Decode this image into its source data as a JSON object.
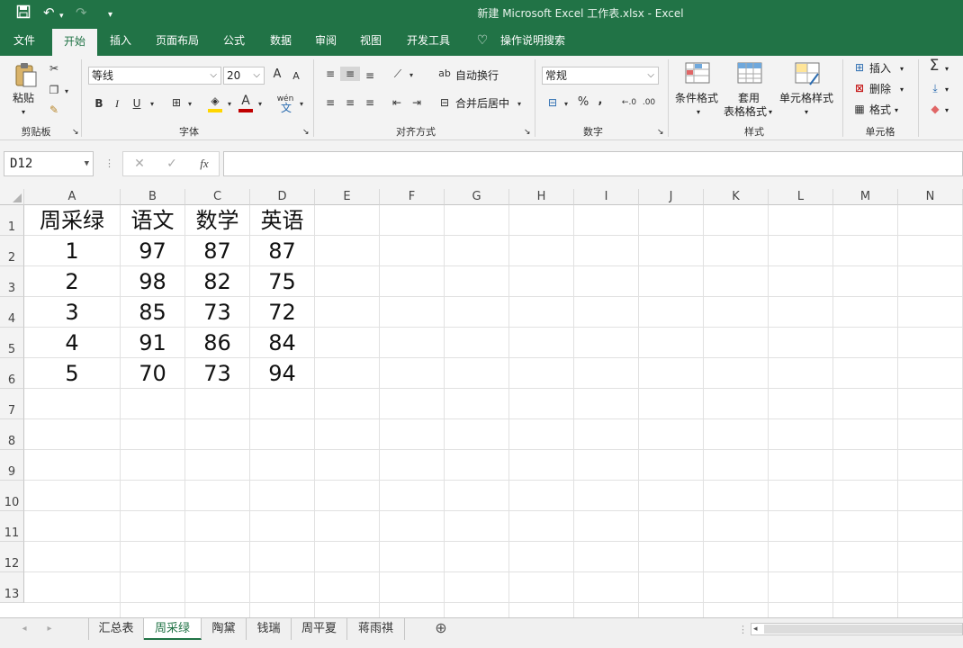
{
  "window": {
    "title": "新建 Microsoft Excel 工作表.xlsx  -  Excel"
  },
  "ribbon_tabs": [
    "文件",
    "开始",
    "插入",
    "页面布局",
    "公式",
    "数据",
    "审阅",
    "视图",
    "开发工具",
    "操作说明搜索"
  ],
  "active_tab": "开始",
  "clipboard": {
    "paste": "粘贴",
    "group": "剪贴板"
  },
  "font": {
    "name": "等线",
    "size": "20",
    "bold": "B",
    "italic": "I",
    "underline": "U",
    "grow": "A",
    "shrink": "A",
    "color_letter": "A",
    "phonetic": "wén",
    "group": "字体"
  },
  "alignment": {
    "wrap": "自动换行",
    "merge": "合并后居中",
    "group": "对齐方式"
  },
  "number": {
    "format": "常规",
    "percent": "%",
    "comma": ",",
    "group": "数字"
  },
  "styles": {
    "conditional": "条件格式",
    "table_line1": "套用",
    "table_line2": "表格格式",
    "cell_styles": "单元格样式",
    "group": "样式"
  },
  "cells": {
    "insert": "插入",
    "delete": "删除",
    "format": "格式",
    "group": "单元格"
  },
  "formula_bar": {
    "name_box": "D12",
    "fx": "fx",
    "cancel": "✕",
    "enter": "✓",
    "content": ""
  },
  "columns": [
    "A",
    "B",
    "C",
    "D",
    "E",
    "F",
    "G",
    "H",
    "I",
    "J",
    "K",
    "L",
    "M",
    "N"
  ],
  "rows": [
    "1",
    "2",
    "3",
    "4",
    "5",
    "6",
    "7",
    "8",
    "9",
    "10",
    "11",
    "12",
    "13"
  ],
  "table": [
    [
      "周采绿",
      "语文",
      "数学",
      "英语"
    ],
    [
      "1",
      "97",
      "87",
      "87"
    ],
    [
      "2",
      "98",
      "82",
      "75"
    ],
    [
      "3",
      "85",
      "73",
      "72"
    ],
    [
      "4",
      "91",
      "86",
      "84"
    ],
    [
      "5",
      "70",
      "73",
      "94"
    ]
  ],
  "sheets": [
    "汇总表",
    "周采绿",
    "陶黛",
    "钱瑞",
    "周平夏",
    "蒋雨祺"
  ],
  "active_sheet": "周采绿",
  "colors": {
    "accent": "#217346",
    "ribbon_bg": "#f3f3f3",
    "font_color_bar": "#c00000",
    "fill_color_bar": "#ffd600"
  }
}
